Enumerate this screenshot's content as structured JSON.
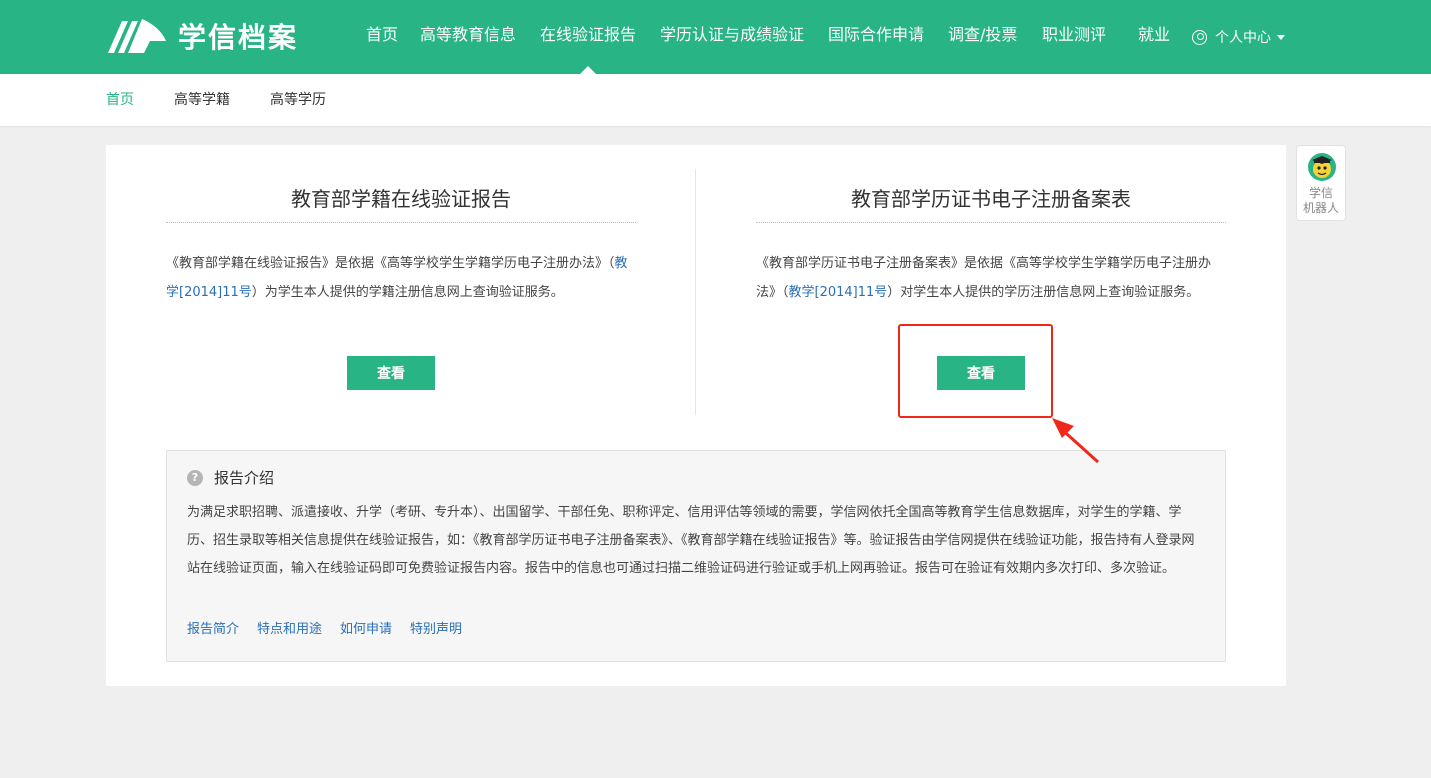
{
  "header": {
    "logo_text": "学信档案",
    "nav": [
      {
        "label": "首页"
      },
      {
        "label": "高等教育信息"
      },
      {
        "label": "在线验证报告"
      },
      {
        "label": "学历认证与成绩验证"
      },
      {
        "label": "国际合作申请"
      },
      {
        "label": "调查/投票"
      },
      {
        "label": "职业测评"
      },
      {
        "label": "就业"
      }
    ],
    "active_nav": "在线验证报告",
    "user_center": "个人中心"
  },
  "subnav": [
    {
      "label": "首页",
      "active": true
    },
    {
      "label": "高等学籍"
    },
    {
      "label": "高等学历"
    }
  ],
  "left_card": {
    "title": "教育部学籍在线验证报告",
    "desc_before": "《教育部学籍在线验证报告》是依据《高等学校学生学籍学历电子注册办法》（",
    "desc_link": "教学[2014]11号",
    "desc_after": "）为学生本人提供的学籍注册信息网上查询验证服务。",
    "button": "查看"
  },
  "right_card": {
    "title": "教育部学历证书电子注册备案表",
    "desc_before": "《教育部学历证书电子注册备案表》是依据《高等学校学生学籍学历电子注册办法》（",
    "desc_link": "教学[2014]11号",
    "desc_after": "）对学生本人提供的学历注册信息网上查询验证服务。",
    "button": "查看"
  },
  "intro": {
    "heading": "报告介绍",
    "help_icon": "?",
    "body": "为满足求职招聘、派遣接收、升学（考研、专升本）、出国留学、干部任免、职称评定、信用评估等领域的需要，学信网依托全国高等教育学生信息数据库，对学生的学籍、学历、招生录取等相关信息提供在线验证报告，如：《教育部学历证书电子注册备案表》、《教育部学籍在线验证报告》等。验证报告由学信网提供在线验证功能，报告持有人登录网站在线验证页面，输入在线验证码即可免费验证报告内容。报告中的信息也可通过扫描二维验证码进行验证或手机上网再验证。报告可在验证有效期内多次打印、多次验证。",
    "links": [
      "报告简介",
      "特点和用途",
      "如何申请",
      "特别声明"
    ]
  },
  "robot": {
    "label_line1": "学信",
    "label_line2": "机器人"
  },
  "colors": {
    "brand": "#28b485",
    "link": "#2a6fb8",
    "annotation": "#f0271b",
    "page_bg": "#efefef"
  }
}
